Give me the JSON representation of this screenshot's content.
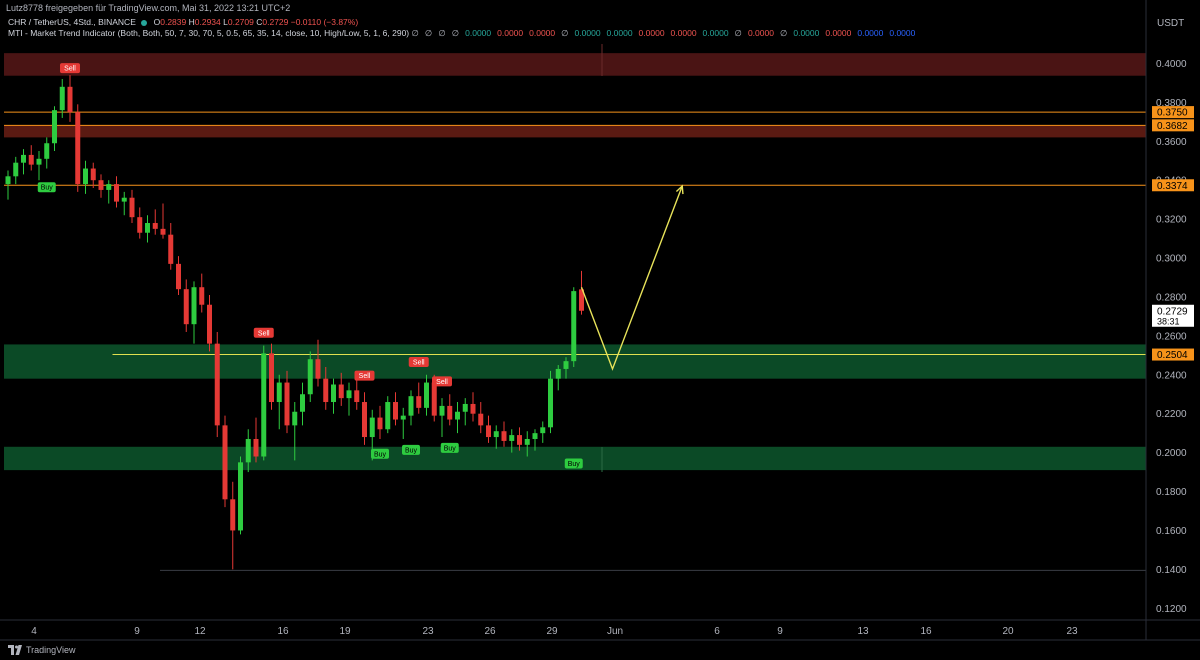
{
  "header": {
    "shared_by": "Lutz8778 freigegeben für TradingView.com, Mai 31, 2022 13:21 UTC+2",
    "symbol": "CHR / TetherUS, 4Std., BINANCE",
    "open_label": "O",
    "open": "0.2839",
    "high_label": "H",
    "high": "0.2934",
    "low_label": "L",
    "low": "0.2709",
    "close_label": "C",
    "close": "0.2729",
    "change": "−0.0110 (−3.87%)",
    "indicator": "MTI - Market Trend Indicator (Both, Both, 50, 7, 30, 70, 5, 0.5, 65, 35, 14, close, 10, High/Low, 5, 1, 6, 290)",
    "indicator_values": [
      {
        "text": "∅",
        "color": "#b2b5be"
      },
      {
        "text": "∅",
        "color": "#b2b5be"
      },
      {
        "text": "∅",
        "color": "#b2b5be"
      },
      {
        "text": "∅",
        "color": "#b2b5be"
      },
      {
        "text": "0.0000",
        "color": "#26a69a"
      },
      {
        "text": "0.0000",
        "color": "#ef5350"
      },
      {
        "text": "0.0000",
        "color": "#ef5350"
      },
      {
        "text": "∅",
        "color": "#b2b5be"
      },
      {
        "text": "0.0000",
        "color": "#26a69a"
      },
      {
        "text": "0.0000",
        "color": "#26a69a"
      },
      {
        "text": "0.0000",
        "color": "#ef5350"
      },
      {
        "text": "0.0000",
        "color": "#ef5350"
      },
      {
        "text": "0.0000",
        "color": "#26a69a"
      },
      {
        "text": "∅",
        "color": "#b2b5be"
      },
      {
        "text": "0.0000",
        "color": "#ef5350"
      },
      {
        "text": "∅",
        "color": "#b2b5be"
      },
      {
        "text": "0.0000",
        "color": "#26a69a"
      },
      {
        "text": "0.0000",
        "color": "#ef5350"
      },
      {
        "text": "0.0000",
        "color": "#2962ff"
      },
      {
        "text": "0.0000",
        "color": "#2962ff"
      }
    ]
  },
  "currency": "USDT",
  "footer": {
    "brand": "TradingView"
  },
  "chart_data": {
    "type": "candlestick",
    "y_range": [
      0.11,
      0.43
    ],
    "y_ticks": [
      "0.4000",
      "0.3800",
      "0.3600",
      "0.3400",
      "0.3200",
      "0.3000",
      "0.2800",
      "0.2600",
      "0.2400",
      "0.2200",
      "0.2000",
      "0.1800",
      "0.1600",
      "0.1400",
      "0.1200"
    ],
    "x_ticks": [
      "4",
      "9",
      "12",
      "16",
      "19",
      "23",
      "26",
      "29",
      "Jun",
      "6",
      "9",
      "13",
      "16",
      "20",
      "23"
    ],
    "price_labels": [
      {
        "value": 0.375,
        "text": "0.3750",
        "bg": "#f7931a",
        "fg": "#000000"
      },
      {
        "value": 0.3682,
        "text": "0.3682",
        "bg": "#f7931a",
        "fg": "#000000"
      },
      {
        "value": 0.3374,
        "text": "0.3374",
        "bg": "#f7931a",
        "fg": "#000000"
      },
      {
        "value": 0.2504,
        "text": "0.2504",
        "bg": "#f7931a",
        "fg": "#000000"
      },
      {
        "value": 0.2729,
        "text": "0.2729",
        "countdown": "38:31",
        "bg": "#ffffff",
        "fg": "#000000"
      }
    ],
    "zones": [
      {
        "from": 0.4053,
        "to": 0.3937,
        "color": "#4a1414"
      },
      {
        "from": 0.3682,
        "to": 0.362,
        "color": "#5a1a12"
      },
      {
        "from": 0.2556,
        "to": 0.238,
        "color": "#0b4a26"
      },
      {
        "from": 0.203,
        "to": 0.191,
        "color": "#0b4a26"
      }
    ],
    "hlines": [
      {
        "value": 0.375,
        "color": "#f7931a"
      },
      {
        "value": 0.3682,
        "color": "#f7931a"
      },
      {
        "value": 0.3374,
        "color": "#f7931a"
      },
      {
        "value": 0.2504,
        "color": "#e0e050",
        "from_bar": 14
      }
    ],
    "candles": [
      [
        0.338,
        0.345,
        0.33,
        0.342
      ],
      [
        0.342,
        0.352,
        0.338,
        0.349
      ],
      [
        0.349,
        0.356,
        0.343,
        0.353
      ],
      [
        0.353,
        0.358,
        0.345,
        0.348
      ],
      [
        0.348,
        0.355,
        0.34,
        0.351
      ],
      [
        0.351,
        0.362,
        0.346,
        0.359
      ],
      [
        0.359,
        0.378,
        0.355,
        0.376
      ],
      [
        0.376,
        0.392,
        0.372,
        0.388
      ],
      [
        0.388,
        0.394,
        0.37,
        0.375
      ],
      [
        0.375,
        0.379,
        0.334,
        0.338
      ],
      [
        0.338,
        0.35,
        0.333,
        0.346
      ],
      [
        0.346,
        0.349,
        0.336,
        0.34
      ],
      [
        0.34,
        0.343,
        0.331,
        0.335
      ],
      [
        0.335,
        0.34,
        0.328,
        0.338
      ],
      [
        0.338,
        0.342,
        0.326,
        0.329
      ],
      [
        0.329,
        0.334,
        0.322,
        0.331
      ],
      [
        0.331,
        0.335,
        0.318,
        0.321
      ],
      [
        0.321,
        0.326,
        0.31,
        0.313
      ],
      [
        0.313,
        0.322,
        0.308,
        0.318
      ],
      [
        0.318,
        0.325,
        0.312,
        0.315
      ],
      [
        0.315,
        0.328,
        0.31,
        0.312
      ],
      [
        0.312,
        0.318,
        0.294,
        0.297
      ],
      [
        0.297,
        0.301,
        0.281,
        0.284
      ],
      [
        0.284,
        0.289,
        0.262,
        0.266
      ],
      [
        0.266,
        0.288,
        0.256,
        0.285
      ],
      [
        0.285,
        0.292,
        0.272,
        0.276
      ],
      [
        0.276,
        0.281,
        0.252,
        0.256
      ],
      [
        0.256,
        0.262,
        0.208,
        0.214
      ],
      [
        0.214,
        0.219,
        0.172,
        0.176
      ],
      [
        0.176,
        0.185,
        0.14,
        0.16
      ],
      [
        0.16,
        0.198,
        0.158,
        0.195
      ],
      [
        0.195,
        0.212,
        0.19,
        0.207
      ],
      [
        0.207,
        0.218,
        0.195,
        0.198
      ],
      [
        0.198,
        0.255,
        0.196,
        0.251
      ],
      [
        0.251,
        0.256,
        0.222,
        0.226
      ],
      [
        0.226,
        0.24,
        0.212,
        0.236
      ],
      [
        0.236,
        0.242,
        0.21,
        0.214
      ],
      [
        0.214,
        0.226,
        0.196,
        0.221
      ],
      [
        0.221,
        0.236,
        0.214,
        0.23
      ],
      [
        0.23,
        0.252,
        0.226,
        0.248
      ],
      [
        0.248,
        0.258,
        0.234,
        0.238
      ],
      [
        0.238,
        0.244,
        0.222,
        0.226
      ],
      [
        0.226,
        0.238,
        0.22,
        0.235
      ],
      [
        0.235,
        0.241,
        0.224,
        0.228
      ],
      [
        0.228,
        0.236,
        0.219,
        0.232
      ],
      [
        0.232,
        0.238,
        0.222,
        0.226
      ],
      [
        0.226,
        0.231,
        0.204,
        0.208
      ],
      [
        0.208,
        0.222,
        0.196,
        0.218
      ],
      [
        0.218,
        0.224,
        0.207,
        0.212
      ],
      [
        0.212,
        0.229,
        0.21,
        0.226
      ],
      [
        0.226,
        0.231,
        0.214,
        0.217
      ],
      [
        0.217,
        0.223,
        0.207,
        0.219
      ],
      [
        0.219,
        0.232,
        0.214,
        0.229
      ],
      [
        0.229,
        0.236,
        0.22,
        0.223
      ],
      [
        0.223,
        0.24,
        0.219,
        0.236
      ],
      [
        0.236,
        0.24,
        0.216,
        0.219
      ],
      [
        0.219,
        0.228,
        0.208,
        0.224
      ],
      [
        0.224,
        0.23,
        0.214,
        0.217
      ],
      [
        0.217,
        0.226,
        0.21,
        0.221
      ],
      [
        0.221,
        0.228,
        0.214,
        0.225
      ],
      [
        0.225,
        0.231,
        0.216,
        0.22
      ],
      [
        0.22,
        0.226,
        0.21,
        0.214
      ],
      [
        0.214,
        0.219,
        0.205,
        0.208
      ],
      [
        0.208,
        0.214,
        0.202,
        0.211
      ],
      [
        0.211,
        0.216,
        0.203,
        0.206
      ],
      [
        0.206,
        0.212,
        0.2,
        0.209
      ],
      [
        0.209,
        0.213,
        0.201,
        0.204
      ],
      [
        0.204,
        0.211,
        0.198,
        0.207
      ],
      [
        0.207,
        0.212,
        0.201,
        0.21
      ],
      [
        0.21,
        0.216,
        0.205,
        0.213
      ],
      [
        0.213,
        0.242,
        0.21,
        0.238
      ],
      [
        0.238,
        0.245,
        0.232,
        0.243
      ],
      [
        0.243,
        0.249,
        0.238,
        0.247
      ],
      [
        0.247,
        0.285,
        0.244,
        0.283
      ],
      [
        0.2839,
        0.2934,
        0.2709,
        0.2729
      ]
    ],
    "signals": [
      {
        "bar": 8,
        "kind": "Sell",
        "value": 0.394
      },
      {
        "bar": 5,
        "kind": "Buy",
        "value": 0.34
      },
      {
        "bar": 33,
        "kind": "Sell",
        "value": 0.258
      },
      {
        "bar": 46,
        "kind": "Sell",
        "value": 0.236
      },
      {
        "bar": 53,
        "kind": "Sell",
        "value": 0.243
      },
      {
        "bar": 56,
        "kind": "Sell",
        "value": 0.233
      },
      {
        "bar": 48,
        "kind": "Buy",
        "value": 0.203
      },
      {
        "bar": 52,
        "kind": "Buy",
        "value": 0.205
      },
      {
        "bar": 57,
        "kind": "Buy",
        "value": 0.206
      },
      {
        "bar": 73,
        "kind": "Buy",
        "value": 0.198
      }
    ],
    "projection": [
      {
        "bar": 74,
        "value": 0.285
      },
      {
        "bar": 78,
        "value": 0.243
      },
      {
        "bar": 87,
        "value": 0.337
      }
    ]
  }
}
